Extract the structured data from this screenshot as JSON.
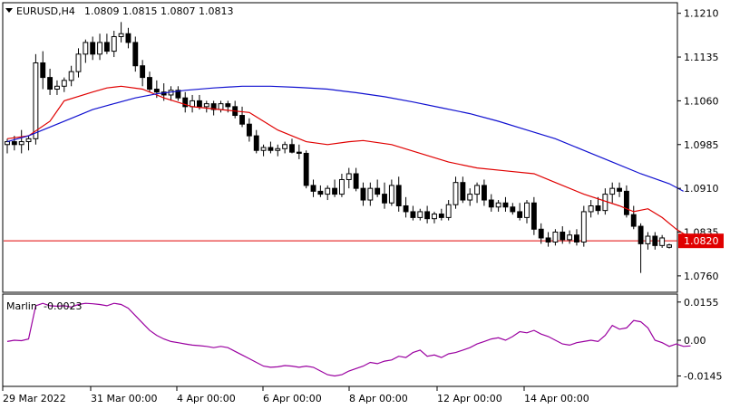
{
  "header": {
    "title": "EURUSD,H4",
    "ohlc": "1.0809 1.0815 1.0807 1.0813"
  },
  "indicator": {
    "name": "Marlin",
    "value": "-0.0023",
    "yticks": [
      "0.0155",
      "0.00",
      "-0.0145"
    ]
  },
  "price_label": "1.0820",
  "colors": {
    "ma_fast": "#e00000",
    "ma_slow": "#1010d0",
    "oscillator": "#9a00a0",
    "level_line": "#e00000",
    "price_label_bg": "#e00000"
  },
  "chart_data": {
    "type": "candlestick",
    "yticks": [
      "1.1210",
      "1.1135",
      "1.1060",
      "1.0985",
      "1.0910",
      "1.0835",
      "1.0760"
    ],
    "xticks": [
      "29 Mar 2022",
      "31 Mar 00:00",
      "4 Apr 00:00",
      "6 Apr 00:00",
      "8 Apr 00:00",
      "12 Apr 00:00",
      "14 Apr 00:00"
    ],
    "ylim": [
      1.0735,
      1.1225
    ],
    "horizontal_line": 1.082,
    "candles": [
      [
        1.0985,
        1.0995,
        1.097,
        1.099
      ],
      [
        1.099,
        1.1,
        1.0975,
        1.0985
      ],
      [
        1.0985,
        1.101,
        1.097,
        1.099
      ],
      [
        1.099,
        1.1,
        1.0975,
        1.0995
      ],
      [
        1.0995,
        1.114,
        1.0985,
        1.1125
      ],
      [
        1.1125,
        1.1145,
        1.108,
        1.11
      ],
      [
        1.11,
        1.1115,
        1.107,
        1.108
      ],
      [
        1.108,
        1.1095,
        1.107,
        1.1085
      ],
      [
        1.1085,
        1.11,
        1.1075,
        1.1095
      ],
      [
        1.1095,
        1.112,
        1.1085,
        1.111
      ],
      [
        1.111,
        1.115,
        1.11,
        1.114
      ],
      [
        1.114,
        1.1165,
        1.1125,
        1.116
      ],
      [
        1.116,
        1.117,
        1.113,
        1.114
      ],
      [
        1.114,
        1.1175,
        1.113,
        1.116
      ],
      [
        1.116,
        1.1175,
        1.114,
        1.1145
      ],
      [
        1.1145,
        1.118,
        1.1135,
        1.117
      ],
      [
        1.117,
        1.1195,
        1.116,
        1.1175
      ],
      [
        1.1175,
        1.1185,
        1.115,
        1.116
      ],
      [
        1.116,
        1.117,
        1.111,
        1.112
      ],
      [
        1.112,
        1.113,
        1.1085,
        1.11
      ],
      [
        1.11,
        1.111,
        1.1075,
        1.108
      ],
      [
        1.108,
        1.1095,
        1.1065,
        1.1075
      ],
      [
        1.1075,
        1.109,
        1.106,
        1.107
      ],
      [
        1.107,
        1.1085,
        1.106,
        1.1078
      ],
      [
        1.1078,
        1.1085,
        1.106,
        1.1065
      ],
      [
        1.1065,
        1.1075,
        1.104,
        1.105
      ],
      [
        1.105,
        1.107,
        1.104,
        1.106
      ],
      [
        1.106,
        1.107,
        1.1045,
        1.105
      ],
      [
        1.105,
        1.106,
        1.104,
        1.1055
      ],
      [
        1.1055,
        1.106,
        1.1035,
        1.1045
      ],
      [
        1.1045,
        1.106,
        1.104,
        1.1055
      ],
      [
        1.1055,
        1.106,
        1.104,
        1.105
      ],
      [
        1.105,
        1.106,
        1.103,
        1.1035
      ],
      [
        1.1035,
        1.105,
        1.1015,
        1.102
      ],
      [
        1.102,
        1.103,
        1.099,
        1.1
      ],
      [
        1.1,
        1.101,
        1.097,
        1.0975
      ],
      [
        1.0975,
        1.0985,
        1.0965,
        1.098
      ],
      [
        1.098,
        1.099,
        1.097,
        1.0975
      ],
      [
        1.0975,
        1.0985,
        1.0965,
        1.0978
      ],
      [
        1.0978,
        1.099,
        1.097,
        1.0985
      ],
      [
        1.0985,
        1.0995,
        1.097,
        1.0972
      ],
      [
        1.0972,
        1.0985,
        1.096,
        1.097
      ],
      [
        1.097,
        1.0975,
        1.091,
        1.0915
      ],
      [
        1.0915,
        1.0925,
        1.0895,
        1.0905
      ],
      [
        1.0905,
        1.0915,
        1.0895,
        1.09
      ],
      [
        1.09,
        1.0915,
        1.089,
        1.091
      ],
      [
        1.091,
        1.0925,
        1.0895,
        1.09
      ],
      [
        1.09,
        1.0935,
        1.0895,
        1.0925
      ],
      [
        1.0925,
        1.0945,
        1.091,
        1.0935
      ],
      [
        1.0935,
        1.0945,
        1.0905,
        1.091
      ],
      [
        1.091,
        1.092,
        1.088,
        1.089
      ],
      [
        1.089,
        1.092,
        1.088,
        1.091
      ],
      [
        1.091,
        1.0925,
        1.0895,
        1.09
      ],
      [
        1.09,
        1.092,
        1.0875,
        1.0885
      ],
      [
        1.0885,
        1.0925,
        1.088,
        1.0915
      ],
      [
        1.0915,
        1.093,
        1.087,
        1.088
      ],
      [
        1.088,
        1.0895,
        1.086,
        1.087
      ],
      [
        1.087,
        1.088,
        1.0855,
        1.086
      ],
      [
        1.086,
        1.0875,
        1.0855,
        1.087
      ],
      [
        1.087,
        1.088,
        1.085,
        1.0858
      ],
      [
        1.0858,
        1.087,
        1.085,
        1.0866
      ],
      [
        1.0866,
        1.0875,
        1.0855,
        1.086
      ],
      [
        1.086,
        1.089,
        1.0855,
        1.0882
      ],
      [
        1.0882,
        1.093,
        1.0875,
        1.092
      ],
      [
        1.092,
        1.093,
        1.0885,
        1.089
      ],
      [
        1.089,
        1.091,
        1.088,
        1.09
      ],
      [
        1.09,
        1.092,
        1.0885,
        1.0915
      ],
      [
        1.0915,
        1.0925,
        1.088,
        1.089
      ],
      [
        1.089,
        1.09,
        1.087,
        1.0878
      ],
      [
        1.0878,
        1.089,
        1.087,
        1.0885
      ],
      [
        1.0885,
        1.0895,
        1.087,
        1.0878
      ],
      [
        1.0878,
        1.0885,
        1.0865,
        1.087
      ],
      [
        1.087,
        1.0885,
        1.0855,
        1.086
      ],
      [
        1.086,
        1.089,
        1.085,
        1.0885
      ],
      [
        1.0885,
        1.0895,
        1.083,
        1.084
      ],
      [
        1.084,
        1.085,
        1.0815,
        1.0825
      ],
      [
        1.0825,
        1.0835,
        1.081,
        1.0818
      ],
      [
        1.0818,
        1.084,
        1.0812,
        1.0835
      ],
      [
        1.0835,
        1.0845,
        1.0815,
        1.0822
      ],
      [
        1.0822,
        1.0838,
        1.0815,
        1.083
      ],
      [
        1.083,
        1.084,
        1.0812,
        1.0818
      ],
      [
        1.0818,
        1.088,
        1.081,
        1.087
      ],
      [
        1.087,
        1.089,
        1.086,
        1.088
      ],
      [
        1.088,
        1.0895,
        1.0865,
        1.0872
      ],
      [
        1.0872,
        1.091,
        1.0865,
        1.09
      ],
      [
        1.09,
        1.092,
        1.0885,
        1.091
      ],
      [
        1.091,
        1.092,
        1.0895,
        1.0905
      ],
      [
        1.0905,
        1.0915,
        1.086,
        1.0865
      ],
      [
        1.0865,
        1.088,
        1.084,
        1.0845
      ],
      [
        1.0845,
        1.085,
        1.0765,
        1.0815
      ],
      [
        1.0815,
        1.0835,
        1.0805,
        1.0828
      ],
      [
        1.0828,
        1.0835,
        1.0805,
        1.0812
      ],
      [
        1.0812,
        1.083,
        1.0808,
        1.0825
      ],
      [
        1.0809,
        1.0815,
        1.0807,
        1.0813
      ]
    ],
    "series": [
      {
        "type": "line",
        "color": "#e00000",
        "x": [
          0,
          3,
          6,
          8,
          12,
          14,
          16,
          19,
          22,
          26,
          30,
          34,
          38,
          42,
          45,
          48,
          50,
          54,
          58,
          62,
          66,
          70,
          74,
          77,
          81,
          86,
          88,
          90,
          92,
          94,
          96
        ],
        "values": [
          1.0995,
          1.1,
          1.1025,
          1.106,
          1.1075,
          1.1082,
          1.1085,
          1.108,
          1.1065,
          1.105,
          1.1045,
          1.104,
          1.101,
          1.099,
          1.0985,
          1.099,
          1.0992,
          1.0985,
          1.097,
          1.0955,
          1.0945,
          1.094,
          1.0935,
          1.092,
          1.09,
          1.088,
          1.087,
          1.0875,
          1.086,
          1.084,
          1.0825
        ]
      },
      {
        "type": "line",
        "color": "#1010d0",
        "x": [
          0,
          3,
          6,
          9,
          12,
          15,
          18,
          21,
          25,
          29,
          33,
          37,
          41,
          45,
          49,
          53,
          57,
          61,
          65,
          69,
          73,
          77,
          81,
          85,
          89,
          93,
          95
        ],
        "values": [
          1.099,
          1.1,
          1.1015,
          1.103,
          1.1045,
          1.1055,
          1.1065,
          1.1072,
          1.1078,
          1.1082,
          1.1085,
          1.1085,
          1.1083,
          1.108,
          1.1074,
          1.1067,
          1.1058,
          1.1048,
          1.1038,
          1.1025,
          1.101,
          1.0995,
          1.0975,
          1.0955,
          1.0935,
          1.0918,
          1.0905
        ]
      }
    ],
    "oscillator": {
      "ylim": [
        -0.018,
        0.018
      ],
      "x": [
        0,
        1,
        2,
        3,
        4,
        5,
        6,
        7,
        8,
        9,
        10,
        11,
        12,
        13,
        14,
        15,
        16,
        17,
        18,
        19,
        20,
        21,
        22,
        23,
        24,
        25,
        26,
        27,
        28,
        29,
        30,
        31,
        32,
        33,
        34,
        35,
        36,
        37,
        38,
        39,
        40,
        41,
        42,
        43,
        44,
        45,
        46,
        47,
        48,
        49,
        50,
        51,
        52,
        53,
        54,
        55,
        56,
        57,
        58,
        59,
        60,
        61,
        62,
        63,
        64,
        65,
        66,
        67,
        68,
        69,
        70,
        71,
        72,
        73,
        74,
        75,
        76,
        77,
        78,
        79,
        80,
        81,
        82,
        83,
        84,
        85,
        86,
        87,
        88,
        89,
        90,
        91,
        92,
        93,
        94,
        95,
        96
      ],
      "values": [
        -0.0005,
        0.0,
        -0.0002,
        0.0005,
        0.014,
        0.015,
        0.014,
        0.0138,
        0.014,
        0.0135,
        0.0145,
        0.015,
        0.0148,
        0.0145,
        0.014,
        0.015,
        0.0145,
        0.013,
        0.01,
        0.007,
        0.004,
        0.002,
        0.0005,
        -0.0005,
        -0.001,
        -0.0015,
        -0.002,
        -0.0022,
        -0.0025,
        -0.003,
        -0.0025,
        -0.003,
        -0.0045,
        -0.006,
        -0.0075,
        -0.009,
        -0.0105,
        -0.011,
        -0.0108,
        -0.0103,
        -0.0105,
        -0.011,
        -0.0105,
        -0.011,
        -0.0125,
        -0.014,
        -0.0145,
        -0.014,
        -0.0125,
        -0.0115,
        -0.0105,
        -0.009,
        -0.0095,
        -0.0085,
        -0.008,
        -0.0065,
        -0.007,
        -0.005,
        -0.004,
        -0.0065,
        -0.006,
        -0.007,
        -0.0055,
        -0.005,
        -0.004,
        -0.003,
        -0.0015,
        -0.0005,
        0.0005,
        0.001,
        0.0,
        0.0015,
        0.0035,
        0.003,
        0.004,
        0.0025,
        0.0015,
        0.0,
        -0.0015,
        -0.002,
        -0.001,
        -0.0005,
        0.0,
        -0.0005,
        0.002,
        0.006,
        0.0045,
        0.005,
        0.008,
        0.0075,
        0.005,
        0.0,
        -0.001,
        -0.0025,
        -0.0015,
        -0.0025,
        -0.0023
      ]
    }
  }
}
